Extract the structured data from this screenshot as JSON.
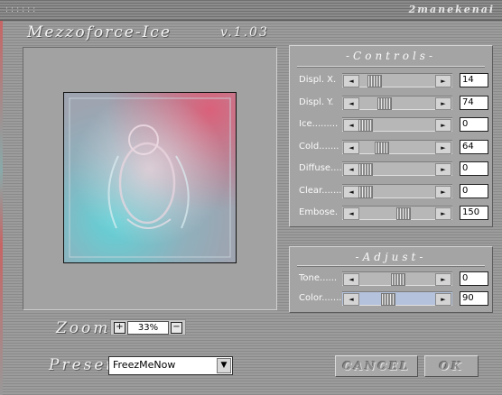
{
  "window": {
    "grip": "::::::",
    "author": "2manekenai",
    "app_name": "Mezzoforce-Ice",
    "version": "v.1.03"
  },
  "controls": {
    "title": "-Controls-",
    "sliders": [
      {
        "label": "Displ. X.",
        "value": "14",
        "level": 0.14
      },
      {
        "label": "Displ. Y.",
        "value": "74",
        "level": 0.29
      },
      {
        "label": "Ice.........",
        "value": "0",
        "level": 0.0
      },
      {
        "label": "Cold.......",
        "value": "64",
        "level": 0.25
      },
      {
        "label": "Diffuse....",
        "value": "0",
        "level": 0.0
      },
      {
        "label": "Clear.......",
        "value": "0",
        "level": 0.0
      },
      {
        "label": "Embose.",
        "value": "150",
        "level": 0.59
      }
    ]
  },
  "adjust": {
    "title": "-Adjust-",
    "sliders": [
      {
        "label": "Tone......",
        "value": "0",
        "level": 0.5,
        "selected": false
      },
      {
        "label": "Color.......",
        "value": "90",
        "level": 0.35,
        "selected": true
      }
    ]
  },
  "zoom": {
    "label": "Zoom",
    "value": "33%",
    "plus": "+",
    "minus": "−"
  },
  "preset": {
    "label": "Preset",
    "value": "FreezMeNow"
  },
  "buttons": {
    "cancel": "CANCEL",
    "ok": "OK"
  },
  "icons": {
    "left_arrow": "arrow-left-icon",
    "right_arrow": "arrow-right-icon",
    "dropdown": "chevron-down-icon"
  },
  "colors": {
    "accent_selected": "#b4c2dc"
  }
}
